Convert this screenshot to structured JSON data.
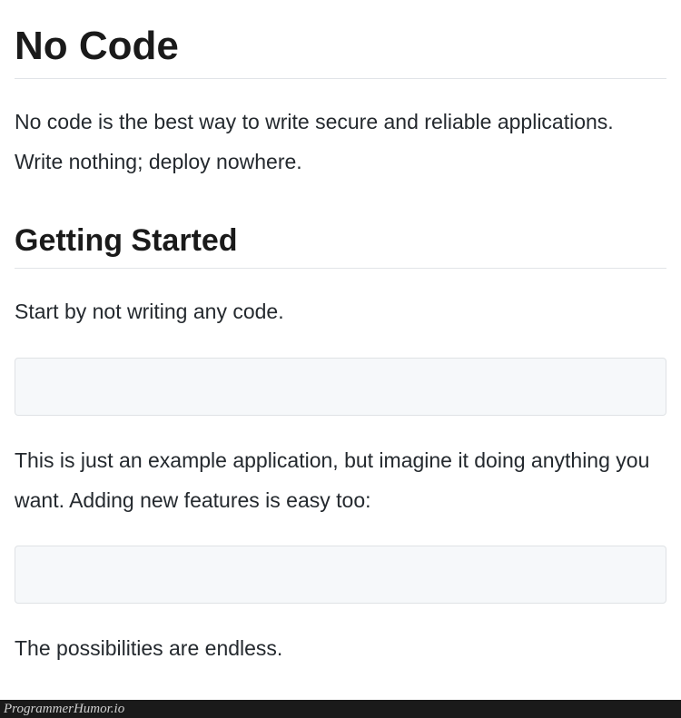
{
  "title": "No Code",
  "intro": "No code is the best way to write secure and reliable applications. Write nothing; deploy nowhere.",
  "section1_heading": "Getting Started",
  "section1_p1": "Start by not writing any code.",
  "codeblock1": "",
  "section1_p2": "This is just an example application, but imagine it doing anything you want. Adding new features is easy too:",
  "codeblock2": "",
  "section1_p3": "The possibilities are endless.",
  "footer": "ProgrammerHumor.io"
}
